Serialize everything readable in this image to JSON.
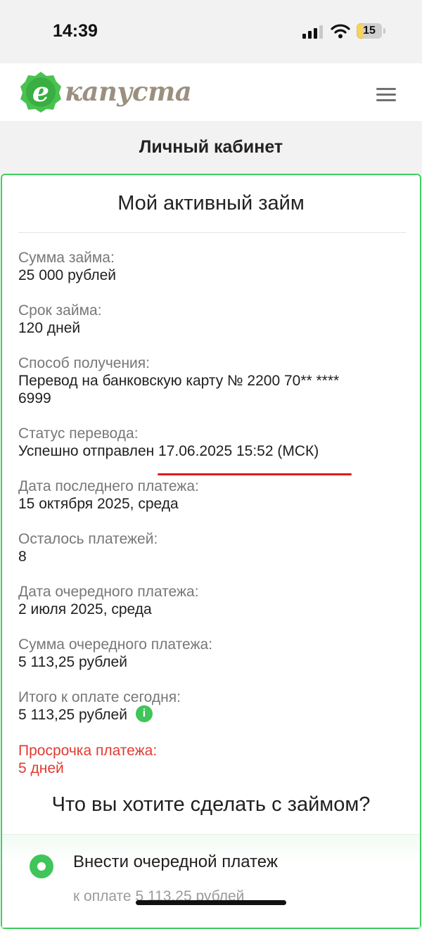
{
  "status_bar": {
    "time": "14:39",
    "battery": "15"
  },
  "header": {
    "logo_text": "капуста",
    "logo_letter": "e",
    "menu_icon": "hamburger-icon"
  },
  "page_title": "Личный кабинет",
  "card": {
    "title": "Мой активный займ",
    "fields": [
      {
        "label": "Сумма займа:",
        "value": "25 000 рублей"
      },
      {
        "label": "Срок займа:",
        "value": "120 дней"
      },
      {
        "label": "Способ получения:",
        "value_line1": "Перевод на банковскую карту № 2200 70** ****",
        "value_line2": "6999"
      },
      {
        "label": "Статус перевода:",
        "value": "Успешно отправлен 17.06.2025 15:52 (МСК)"
      },
      {
        "label": "Дата последнего платежа:",
        "value": "15 октября 2025, среда"
      },
      {
        "label": "Осталось платежей:",
        "value": "8"
      },
      {
        "label": "Дата очередного платежа:",
        "value": "2 июля 2025, среда"
      },
      {
        "label": "Сумма очередного платежа:",
        "value": "5 113,25 рублей"
      },
      {
        "label": "Итого к оплате сегодня:",
        "value": "5 113,25 рублей",
        "icon": "info-icon"
      },
      {
        "label": "Просрочка платежа:",
        "value": "5 дней"
      }
    ],
    "question": "Что вы хотите сделать с займом?",
    "option": {
      "label": "Внести очередной платеж",
      "sub": "к оплате 5 113,25 рублей"
    }
  },
  "colors": {
    "accent_green": "#3fc55a",
    "border_green": "#3ecf5e",
    "overdue_red": "#e03c31",
    "underline_red": "#e11b1b"
  }
}
